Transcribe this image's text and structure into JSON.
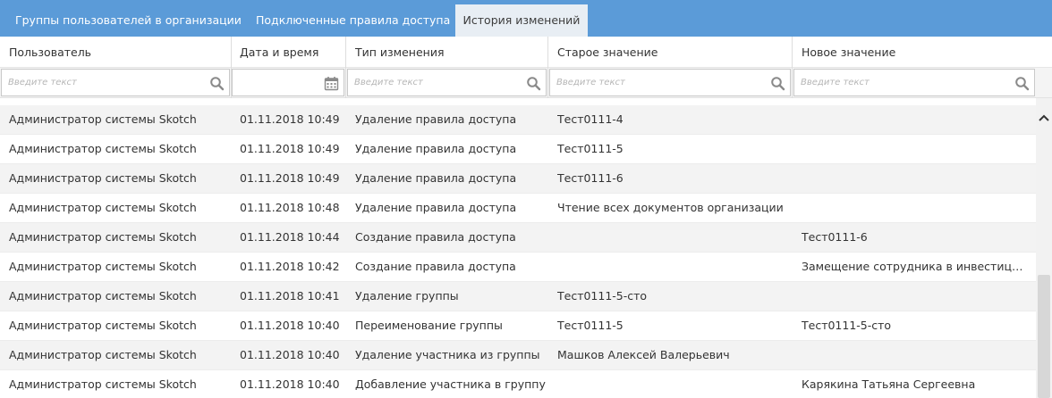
{
  "tabs": [
    {
      "label": "Группы пользователей в организации",
      "active": false
    },
    {
      "label": "Подключенные правила доступа",
      "active": false
    },
    {
      "label": "История изменений",
      "active": true
    }
  ],
  "columns": [
    "Пользователь",
    "Дата и время",
    "Тип изменения",
    "Старое значение",
    "Новое значение"
  ],
  "filters": {
    "user_placeholder": "Введите текст",
    "type_placeholder": "Введите текст",
    "old_placeholder": "Введите текст",
    "new_placeholder": "Введите текст",
    "search_icon": "search-icon",
    "calendar_icon": "calendar-icon"
  },
  "rows": [
    [
      "Администратор системы Skotch",
      "01.11.2018 10:49",
      "Удаление правила доступа",
      "Тест0111-4",
      ""
    ],
    [
      "Администратор системы Skotch",
      "01.11.2018 10:49",
      "Удаление правила доступа",
      "Тест0111-5",
      ""
    ],
    [
      "Администратор системы Skotch",
      "01.11.2018 10:49",
      "Удаление правила доступа",
      "Тест0111-6",
      ""
    ],
    [
      "Администратор системы Skotch",
      "01.11.2018 10:48",
      "Удаление правила доступа",
      "Чтение всех документов организации",
      ""
    ],
    [
      "Администратор системы Skotch",
      "01.11.2018 10:44",
      "Создание правила доступа",
      "",
      "Тест0111-6"
    ],
    [
      "Администратор системы Skotch",
      "01.11.2018 10:42",
      "Создание правила доступа",
      "",
      "Замещение сотрудника в инвестицио..."
    ],
    [
      "Администратор системы Skotch",
      "01.11.2018 10:41",
      "Удаление группы",
      "Тест0111-5-сто",
      ""
    ],
    [
      "Администратор системы Skotch",
      "01.11.2018 10:40",
      "Переименование группы",
      "Тест0111-5",
      "Тест0111-5-сто"
    ],
    [
      "Администратор системы Skotch",
      "01.11.2018 10:40",
      "Удаление участника из группы",
      "Машков Алексей Валерьевич",
      ""
    ],
    [
      "Администратор системы Skotch",
      "01.11.2018 10:40",
      "Добавление участника в группу",
      "",
      "Карякина Татьяна Сергеевна"
    ]
  ],
  "colors": {
    "tab_bar": "#5b9bd8",
    "active_tab": "#e8eef4",
    "row_stripe": "#f3f3f3"
  }
}
